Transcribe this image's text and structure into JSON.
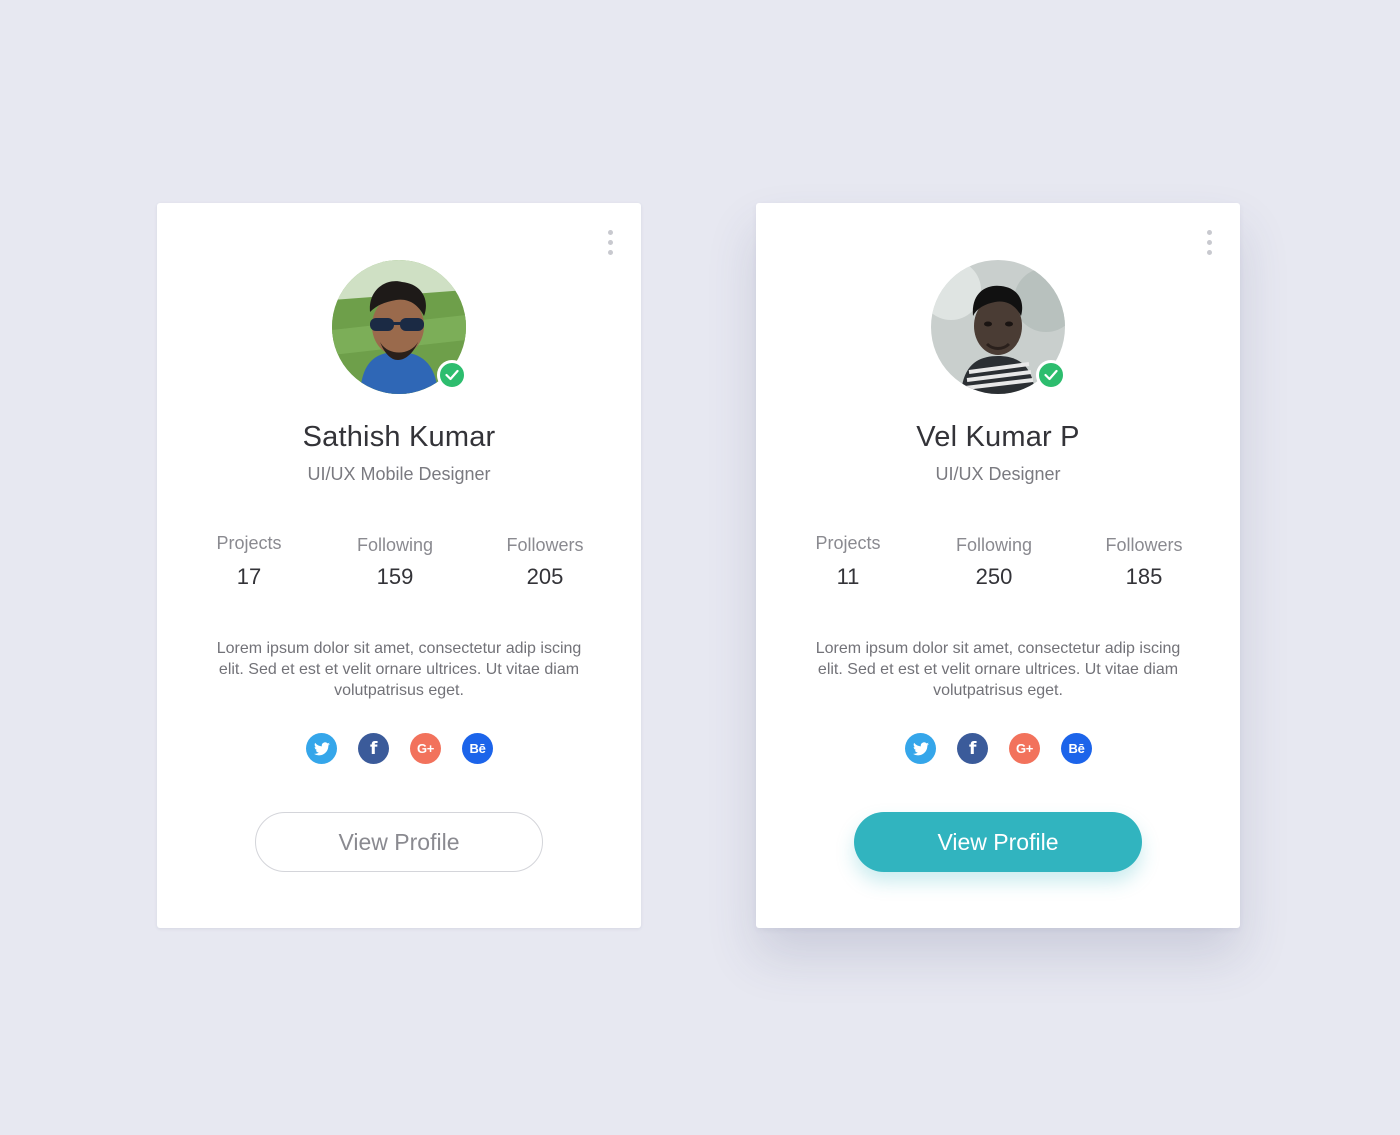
{
  "cards": [
    {
      "name": "Sathish Kumar",
      "role": "UI/UX Mobile Designer",
      "stats": [
        {
          "label": "Projects",
          "value": "17"
        },
        {
          "label": "Following",
          "value": "159"
        },
        {
          "label": "Followers",
          "value": "205"
        }
      ],
      "bio": "Lorem ipsum dolor sit amet, consectetur adip iscing elit. Sed et est et velit ornare ultrices. Ut vitae diam volutpatrisus eget.",
      "socials": [
        {
          "icon": "twitter-icon"
        },
        {
          "icon": "facebook-icon",
          "text": "f"
        },
        {
          "icon": "google-plus-icon",
          "text": "G+"
        },
        {
          "icon": "behance-icon",
          "text": "Bē"
        }
      ],
      "button_label": "View Profile",
      "button_style": "outline",
      "verified": true
    },
    {
      "name": "Vel Kumar P",
      "role": "UI/UX Designer",
      "stats": [
        {
          "label": "Projects",
          "value": "11"
        },
        {
          "label": "Following",
          "value": "250"
        },
        {
          "label": "Followers",
          "value": "185"
        }
      ],
      "bio": "Lorem ipsum dolor sit amet, consectetur adip iscing elit. Sed et est et velit ornare ultrices. Ut vitae diam volutpatrisus eget.",
      "socials": [
        {
          "icon": "twitter-icon"
        },
        {
          "icon": "facebook-icon",
          "text": "f"
        },
        {
          "icon": "google-plus-icon",
          "text": "G+"
        },
        {
          "icon": "behance-icon",
          "text": "Bē"
        }
      ],
      "button_label": "View Profile",
      "button_style": "filled",
      "verified": true
    }
  ],
  "colors": {
    "background": "#e7e8f1",
    "accent": "#31b4bf",
    "verified": "#2dbd6e",
    "twitter": "#35a6ea",
    "facebook": "#3b5b9a",
    "google_plus": "#f2725c",
    "behance": "#1c64ea"
  }
}
